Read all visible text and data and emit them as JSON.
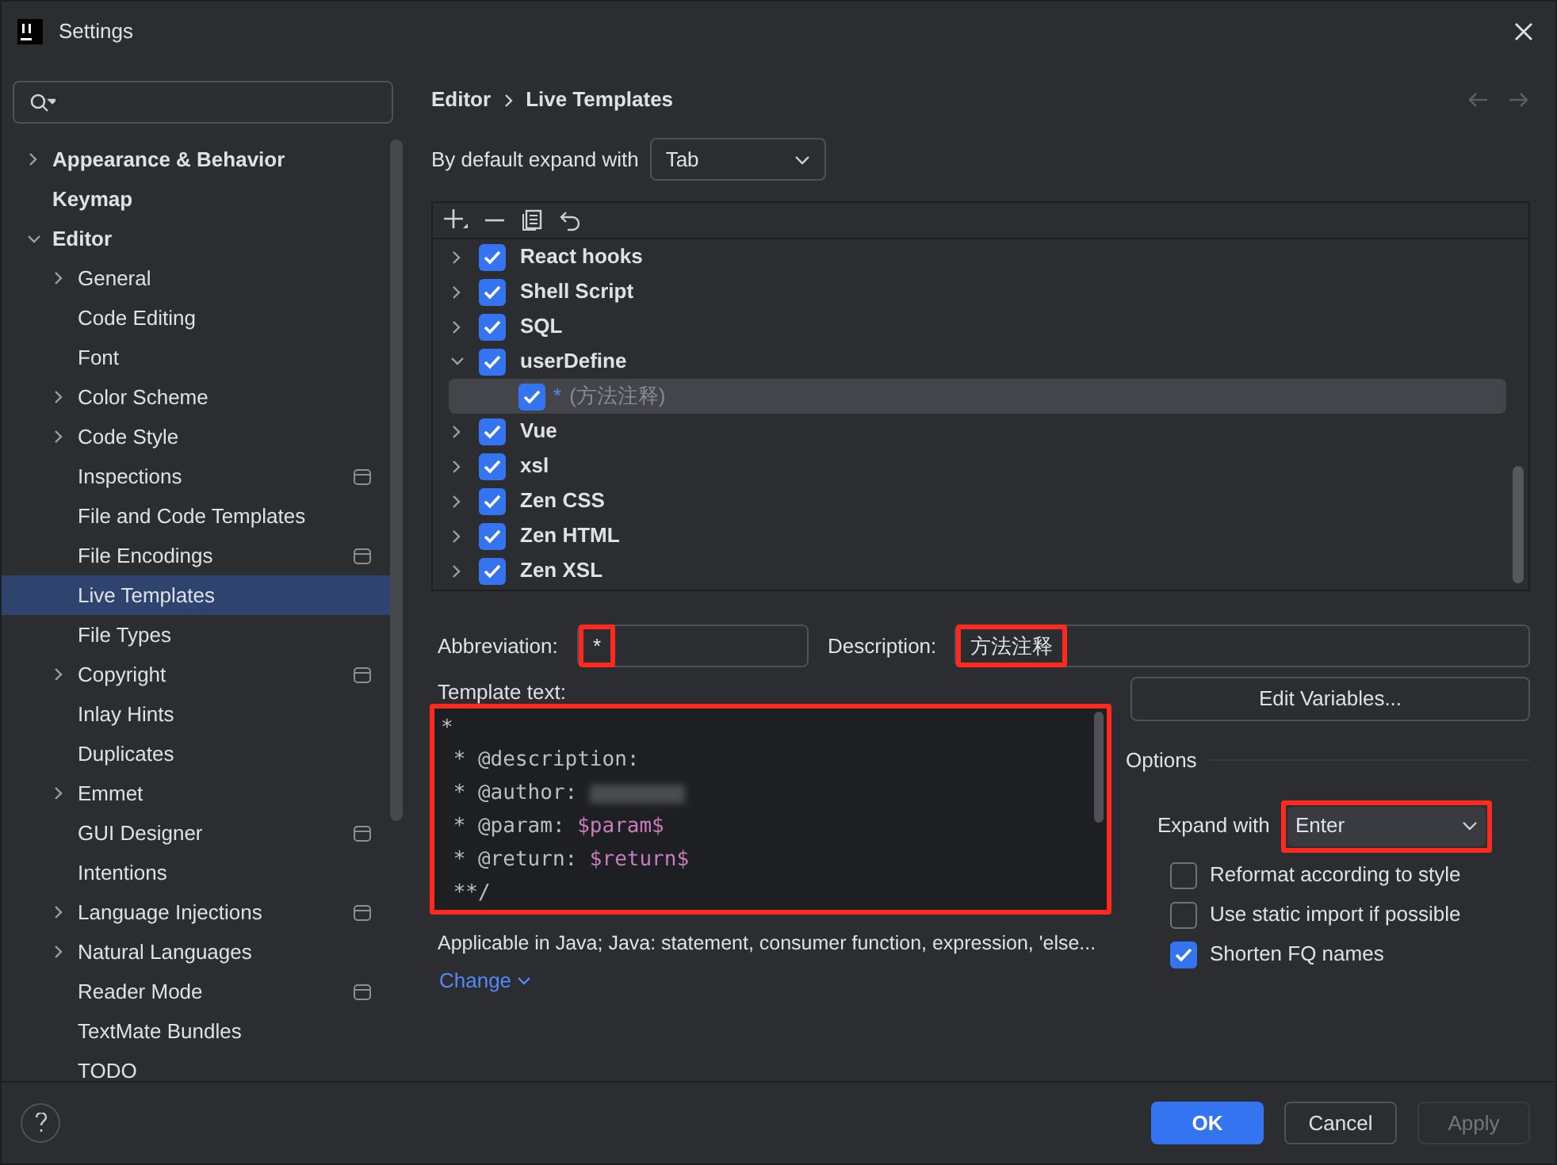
{
  "window": {
    "title": "Settings"
  },
  "sidebar": {
    "items": [
      {
        "label": "Appearance & Behavior",
        "expanded": false,
        "has_children": true,
        "selected": false,
        "scope_icon": false
      },
      {
        "label": "Keymap",
        "has_children": false,
        "selected": false,
        "scope_icon": false
      },
      {
        "label": "Editor",
        "expanded": true,
        "has_children": true,
        "selected": false,
        "scope_icon": false,
        "children": [
          {
            "label": "General",
            "has_children": true,
            "expanded": false,
            "selected": false,
            "scope_icon": false
          },
          {
            "label": "Code Editing",
            "has_children": false,
            "selected": false,
            "scope_icon": false
          },
          {
            "label": "Font",
            "has_children": false,
            "selected": false,
            "scope_icon": false
          },
          {
            "label": "Color Scheme",
            "has_children": true,
            "expanded": false,
            "selected": false,
            "scope_icon": false
          },
          {
            "label": "Code Style",
            "has_children": true,
            "expanded": false,
            "selected": false,
            "scope_icon": false
          },
          {
            "label": "Inspections",
            "has_children": false,
            "selected": false,
            "scope_icon": true
          },
          {
            "label": "File and Code Templates",
            "has_children": false,
            "selected": false,
            "scope_icon": false
          },
          {
            "label": "File Encodings",
            "has_children": false,
            "selected": false,
            "scope_icon": true
          },
          {
            "label": "Live Templates",
            "has_children": false,
            "selected": true,
            "scope_icon": false
          },
          {
            "label": "File Types",
            "has_children": false,
            "selected": false,
            "scope_icon": false
          },
          {
            "label": "Copyright",
            "has_children": true,
            "expanded": false,
            "selected": false,
            "scope_icon": true
          },
          {
            "label": "Inlay Hints",
            "has_children": false,
            "selected": false,
            "scope_icon": false
          },
          {
            "label": "Duplicates",
            "has_children": false,
            "selected": false,
            "scope_icon": false
          },
          {
            "label": "Emmet",
            "has_children": true,
            "expanded": false,
            "selected": false,
            "scope_icon": false
          },
          {
            "label": "GUI Designer",
            "has_children": false,
            "selected": false,
            "scope_icon": true
          },
          {
            "label": "Intentions",
            "has_children": false,
            "selected": false,
            "scope_icon": false
          },
          {
            "label": "Language Injections",
            "has_children": true,
            "expanded": false,
            "selected": false,
            "scope_icon": true
          },
          {
            "label": "Natural Languages",
            "has_children": true,
            "expanded": false,
            "selected": false,
            "scope_icon": false
          },
          {
            "label": "Reader Mode",
            "has_children": false,
            "selected": false,
            "scope_icon": true
          },
          {
            "label": "TextMate Bundles",
            "has_children": false,
            "selected": false,
            "scope_icon": false
          },
          {
            "label": "TODO",
            "has_children": false,
            "selected": false,
            "scope_icon": false
          }
        ]
      }
    ]
  },
  "breadcrumb": [
    "Editor",
    "Live Templates"
  ],
  "default_expand": {
    "label": "By default expand with",
    "value": "Tab"
  },
  "template_groups": [
    {
      "label": "React hooks",
      "checked": true,
      "expanded": false
    },
    {
      "label": "Shell Script",
      "checked": true,
      "expanded": false
    },
    {
      "label": "SQL",
      "checked": true,
      "expanded": false
    },
    {
      "label": "userDefine",
      "checked": true,
      "expanded": true,
      "children": [
        {
          "abbreviation": "*",
          "description": "(方法注释)",
          "checked": true,
          "selected": true
        }
      ]
    },
    {
      "label": "Vue",
      "checked": true,
      "expanded": false
    },
    {
      "label": "xsl",
      "checked": true,
      "expanded": false
    },
    {
      "label": "Zen CSS",
      "checked": true,
      "expanded": false
    },
    {
      "label": "Zen HTML",
      "checked": true,
      "expanded": false
    },
    {
      "label": "Zen XSL",
      "checked": true,
      "expanded": false
    }
  ],
  "abbreviation": {
    "label": "Abbreviation:",
    "value": "*",
    "highlighted": true
  },
  "description": {
    "label": "Description:",
    "value": "方法注释",
    "highlighted": true
  },
  "template_text": {
    "label": "Template text:",
    "highlighted": true,
    "lines": [
      [
        {
          "kind": "plain",
          "text": "*"
        }
      ],
      [
        {
          "kind": "plain",
          "text": " * @description:"
        }
      ],
      [
        {
          "kind": "plain",
          "text": " * @author: "
        },
        {
          "kind": "redacted"
        }
      ],
      [
        {
          "kind": "plain",
          "text": " * @param: "
        },
        {
          "kind": "variable",
          "text": "$param$"
        }
      ],
      [
        {
          "kind": "plain",
          "text": " * @return: "
        },
        {
          "kind": "variable",
          "text": "$return$"
        }
      ],
      [
        {
          "kind": "plain",
          "text": " **/"
        }
      ]
    ]
  },
  "edit_variables_button": "Edit Variables...",
  "options": {
    "title": "Options",
    "expand_with": {
      "label": "Expand with",
      "value": "Enter",
      "highlighted": true
    },
    "checkboxes": [
      {
        "label": "Reformat according to style",
        "checked": false
      },
      {
        "label": "Use static import if possible",
        "checked": false
      },
      {
        "label": "Shorten FQ names",
        "checked": true
      }
    ]
  },
  "applicable": "Applicable in Java; Java: statement, consumer function, expression, 'else...",
  "change_link": "Change",
  "buttons": [
    {
      "label": "OK",
      "kind": "primary",
      "disabled": false
    },
    {
      "label": "Cancel",
      "kind": "secondary",
      "disabled": false
    },
    {
      "label": "Apply",
      "kind": "secondary",
      "disabled": true
    }
  ]
}
